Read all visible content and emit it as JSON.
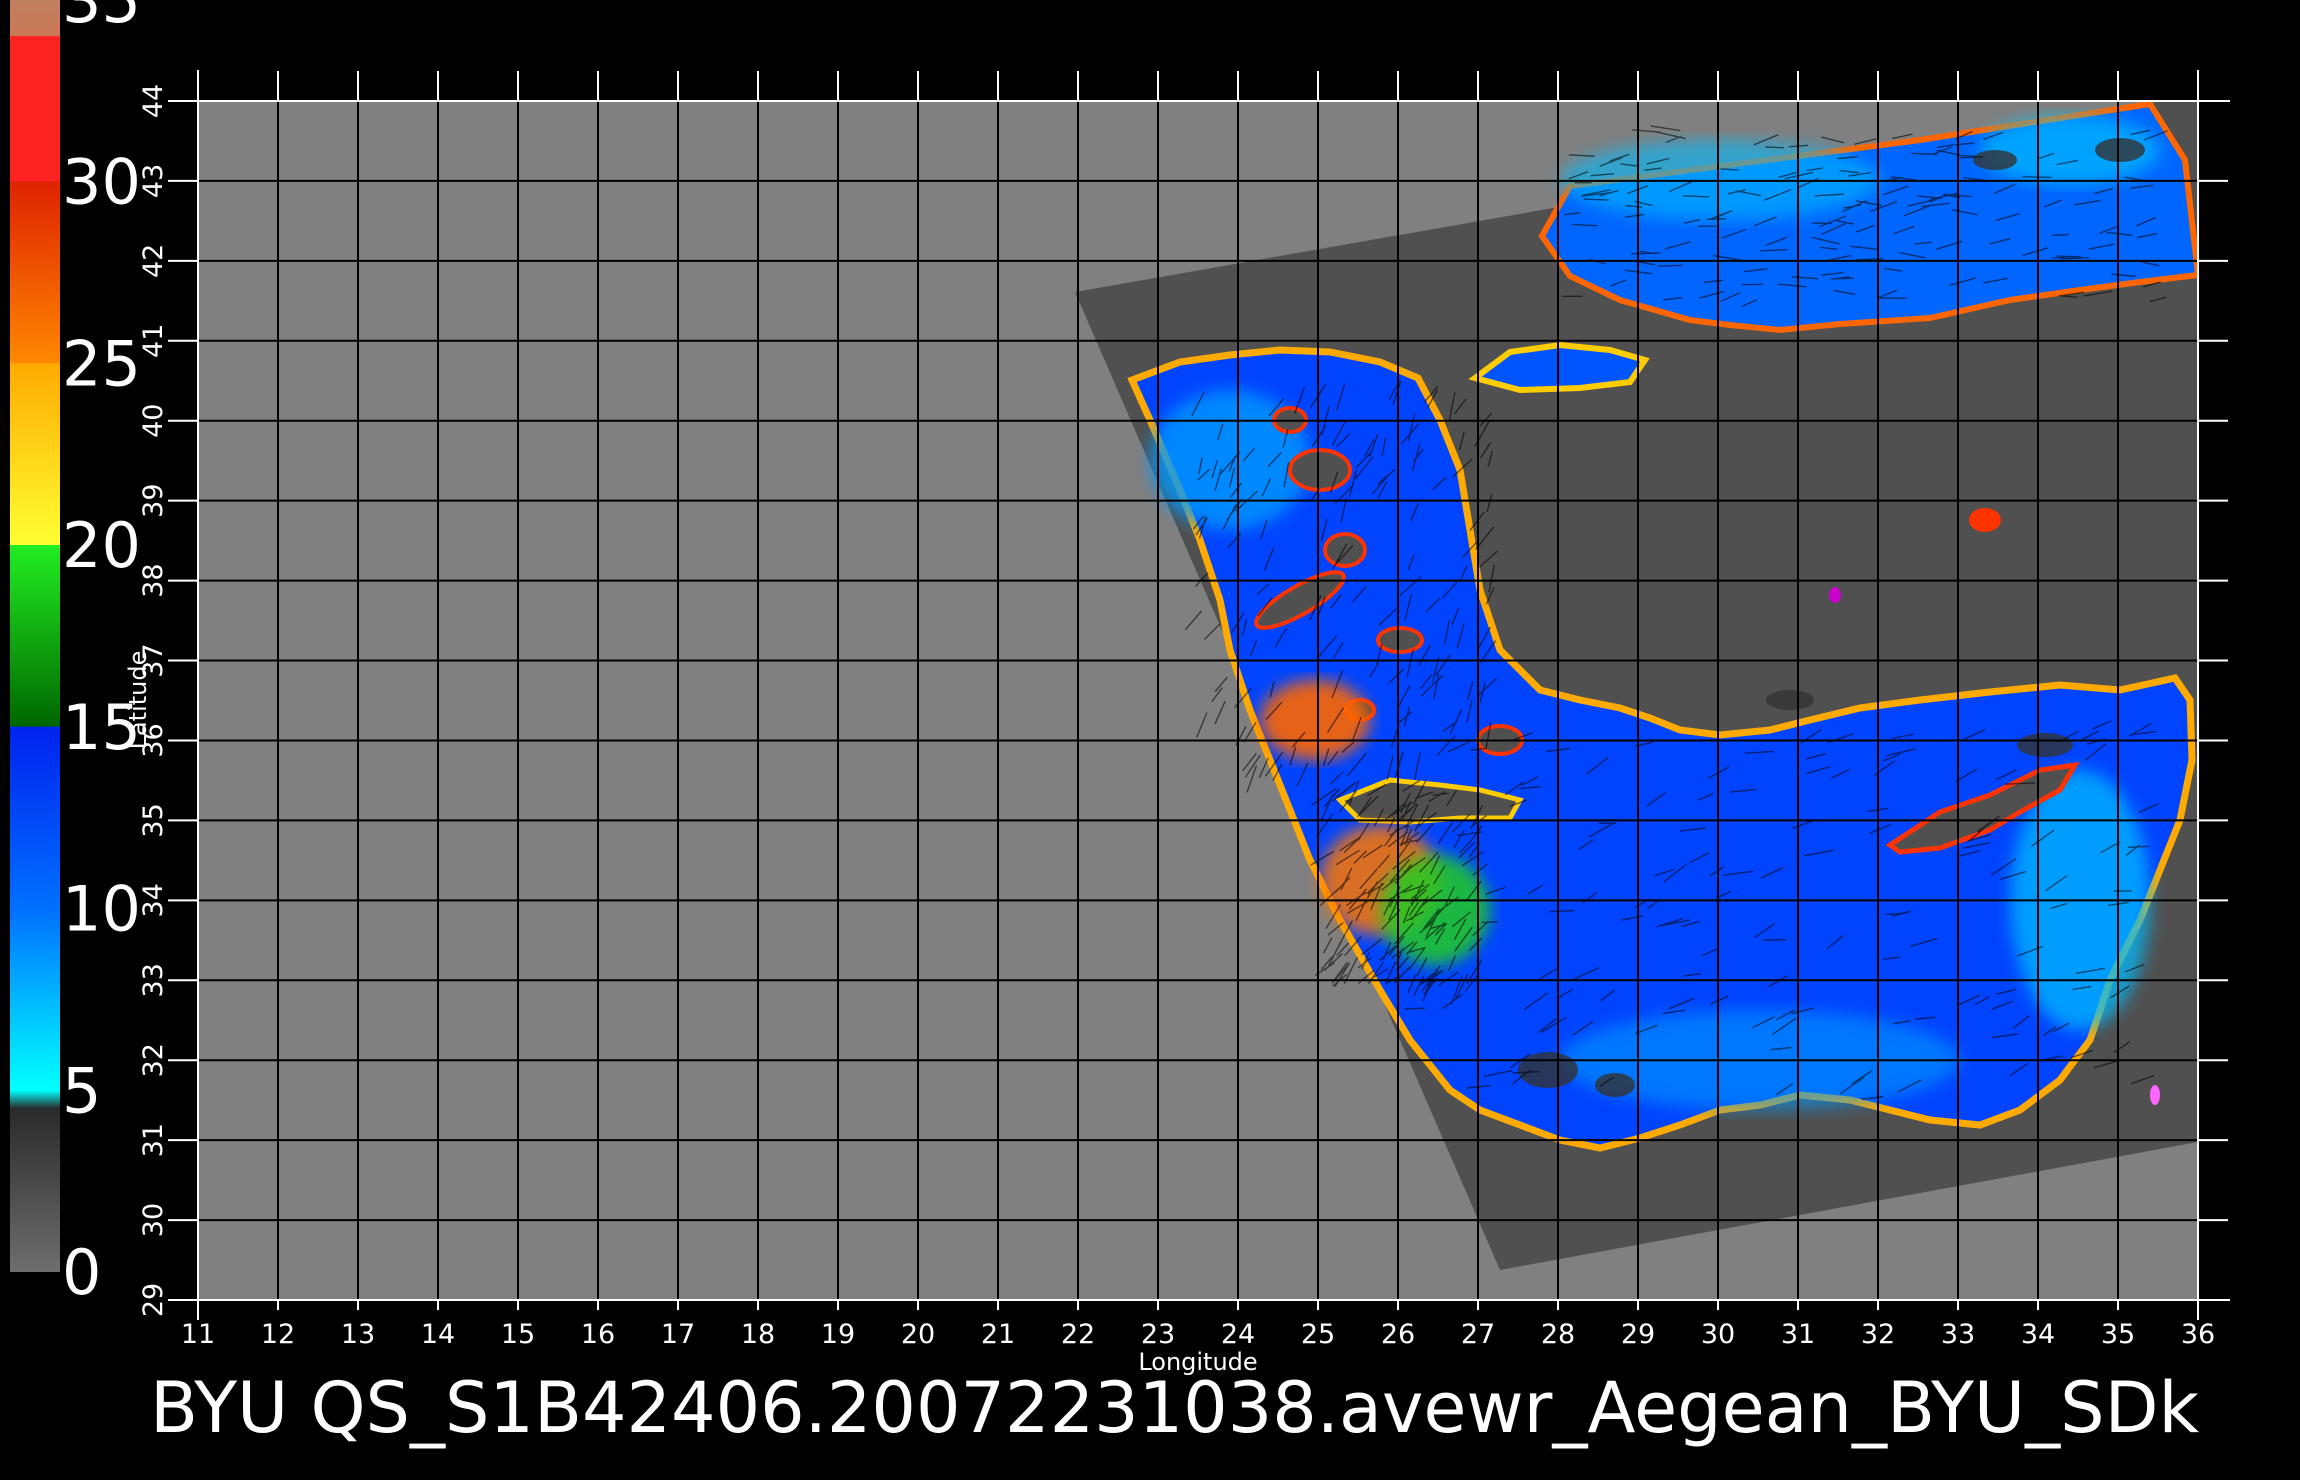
{
  "title": "BYU  QS_S1B42406.20072231038.avewr_Aegean_BYU_SDk",
  "xlabel": "Longitude",
  "ylabel": "Latitude",
  "longitude_ticks": [
    "11",
    "12",
    "13",
    "14",
    "15",
    "16",
    "17",
    "18",
    "19",
    "20",
    "21",
    "22",
    "23",
    "24",
    "25",
    "26",
    "27",
    "28",
    "29",
    "30",
    "31",
    "32",
    "33",
    "34",
    "35",
    "36"
  ],
  "latitude_ticks": [
    "29",
    "30",
    "31",
    "32",
    "33",
    "34",
    "35",
    "36",
    "37",
    "38",
    "39",
    "40",
    "41",
    "42",
    "43",
    "44"
  ],
  "colorbar": {
    "labels": [
      "0",
      "5",
      "10",
      "15",
      "20",
      "25",
      "30",
      "35"
    ],
    "stops": [
      {
        "value": 0,
        "color": "#6e6e6e"
      },
      {
        "value": 4.5,
        "color": "#2a2a2a"
      },
      {
        "value": 5,
        "color": "#00ffff"
      },
      {
        "value": 10,
        "color": "#0070ff"
      },
      {
        "value": 15,
        "color": "#0022ee"
      },
      {
        "value": 15.01,
        "color": "#006600"
      },
      {
        "value": 20,
        "color": "#22ee22"
      },
      {
        "value": 20.01,
        "color": "#ffff33"
      },
      {
        "value": 25,
        "color": "#ffaa00"
      },
      {
        "value": 25.01,
        "color": "#ff8800"
      },
      {
        "value": 30,
        "color": "#dd2200"
      },
      {
        "value": 30.01,
        "color": "#ff2222"
      },
      {
        "value": 34,
        "color": "#ff2222"
      },
      {
        "value": 34.01,
        "color": "#cc7755"
      },
      {
        "value": 35,
        "color": "#c08060"
      }
    ]
  },
  "colors": {
    "background": "#000000",
    "land_outside_swath": "#808080",
    "swath_land": "#505050",
    "grid": "#000000",
    "wind_low": "#00c8ff",
    "wind_mid": "#0050ff",
    "wind_high": "#ff8800"
  }
}
